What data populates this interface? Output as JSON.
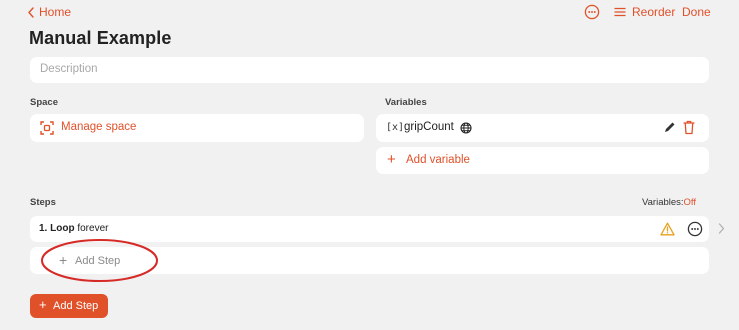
{
  "nav": {
    "back_label": "Home",
    "more_icon": "ellipsis-circle-icon",
    "reorder_label": "Reorder",
    "done_label": "Done"
  },
  "page": {
    "title": "Manual Example"
  },
  "description": {
    "placeholder": "Description",
    "value": ""
  },
  "space": {
    "heading": "Space",
    "manage_label": "Manage space",
    "icon": "viewfinder-icon"
  },
  "variables": {
    "heading": "Variables",
    "items": [
      {
        "type_glyph": "[x]",
        "name": "gripCount",
        "scope_icon": "globe-icon"
      }
    ],
    "add_label": "Add variable",
    "add_glyph": "+"
  },
  "steps": {
    "heading": "Steps",
    "variables_toggle_label": "Variables:",
    "variables_toggle_value": "Off",
    "items": [
      {
        "index": "1.",
        "name": "Loop",
        "detail": "forever",
        "has_warning": true
      }
    ],
    "add_row_label": "Add Step",
    "add_row_glyph": "+",
    "add_button_label": "Add Step",
    "add_button_glyph": "+"
  },
  "colors": {
    "accent": "#e0512a",
    "background": "#f1f1f1",
    "card": "#ffffff",
    "warning": "#e8a11c",
    "annotation": "#d62a26"
  }
}
